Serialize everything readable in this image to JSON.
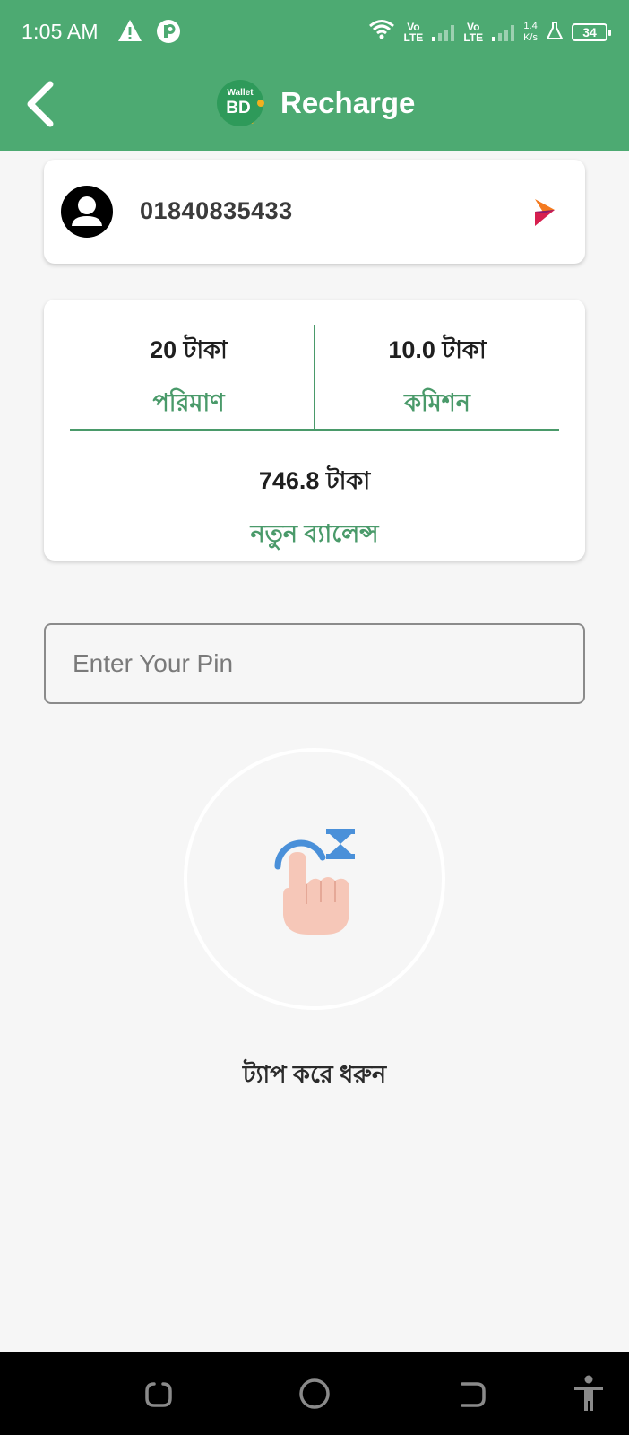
{
  "status_bar": {
    "time": "1:05 AM",
    "net1": "Vo\nLTE",
    "net1_top": "Vo",
    "net1_bottom": "LTE",
    "net2_top": "Vo",
    "net2_bottom": "LTE",
    "speed_value": "1.4",
    "speed_unit": "K/s",
    "battery": "34"
  },
  "app_bar": {
    "logo_text_small": "Wallet",
    "logo_text_big": "BD",
    "title": "Recharge"
  },
  "recipient": {
    "number": "01840835433",
    "operator_icon": "robi-operator-icon"
  },
  "summary": {
    "amount_value": "20 টাকা",
    "amount_label": "পরিমাণ",
    "commission_value": "10.0 টাকা",
    "commission_label": "কমিশন",
    "balance_value": "746.8 টাকা",
    "balance_label": "নতুন ব্যালেন্স"
  },
  "pin": {
    "placeholder": "Enter Your Pin",
    "value": ""
  },
  "tap": {
    "label": "ট্যাপ করে ধরুন",
    "icon": "tap-hold-hand-icon"
  },
  "colors": {
    "primary": "#4daa72",
    "label_green": "#4a9a6a",
    "background": "#f6f6f6"
  }
}
